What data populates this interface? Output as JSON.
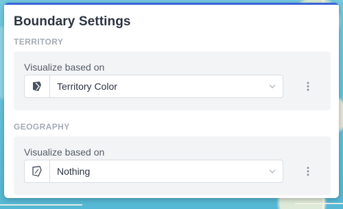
{
  "panel": {
    "title": "Boundary Settings",
    "accent_color": "#3a63d8"
  },
  "sections": [
    {
      "label": "TERRITORY",
      "field_label": "Visualize based on",
      "selected_value": "Territory Color",
      "icon": "territory-color-icon"
    },
    {
      "label": "GEOGRAPHY",
      "field_label": "Visualize based on",
      "selected_value": "Nothing",
      "icon": "geography-outline-icon"
    }
  ]
}
